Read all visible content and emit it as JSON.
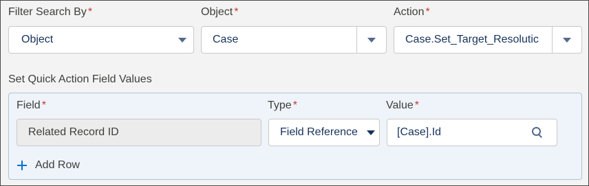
{
  "filter_search": {
    "label": "Filter Search By",
    "required_mark": "*",
    "value": "Object"
  },
  "object": {
    "label": "Object",
    "required_mark": "*",
    "value": "Case"
  },
  "action": {
    "label": "Action",
    "required_mark": "*",
    "value": "Case.Set_Target_Resolutic"
  },
  "quick_action": {
    "section_label": "Set Quick Action Field Values",
    "columns": {
      "field": {
        "label": "Field",
        "required_mark": "*"
      },
      "type": {
        "label": "Type",
        "required_mark": "*"
      },
      "value": {
        "label": "Value",
        "required_mark": "*"
      }
    },
    "rows": [
      {
        "field": "Related Record ID",
        "type": "Field Reference",
        "value": "[Case].Id"
      }
    ],
    "add_row_label": "Add Row"
  },
  "icons": {
    "dropdown": "chevron-down-icon",
    "search": "search-icon",
    "add": "plus-icon"
  },
  "colors": {
    "required": "#c23934",
    "accent": "#0070d2",
    "panel_background": "#eef4f9"
  }
}
